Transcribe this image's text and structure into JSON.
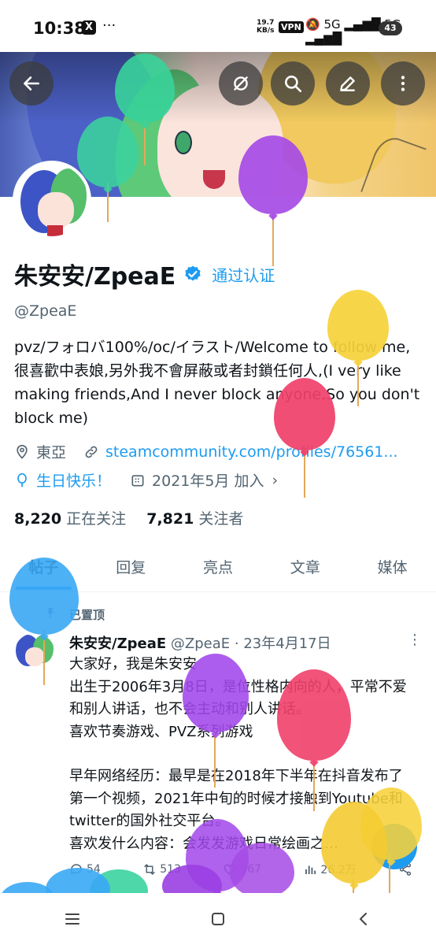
{
  "status_bar": {
    "time": "10:38",
    "x_glyph": "X",
    "more": "···",
    "net_speed_value": "19.7",
    "net_speed_unit": "KB/s",
    "vpn": "VPN",
    "signal_icons": "🔕 5G ▂▄▆█ 5G ▂▄▆█",
    "battery": "43"
  },
  "header": {
    "icons": [
      "back-arrow-icon",
      "refresh-slash-icon",
      "search-icon",
      "edit-pencil-icon",
      "more-vertical-icon"
    ]
  },
  "profile": {
    "name": "朱安安/ZpeaE",
    "verify_label": "通过认证",
    "handle": "@ZpeaE",
    "bio": "pvz/フォロバ100%/oc/イラスト/Welcome to follow me,很喜歡中表娘,另外我不會屏蔽或者封鎖任何人,(I very like making friends,And I never block anyone,So you don't block me)",
    "location": "東亞",
    "link": "steamcommunity.com/profiles/76561...",
    "birthday": "生日快乐！",
    "joined": "2021年5月 加入",
    "following_count": "8,220",
    "following_label": "正在关注",
    "followers_count": "7,821",
    "followers_label": "关注者"
  },
  "tabs": [
    {
      "label": "帖子",
      "active": true
    },
    {
      "label": "回复",
      "active": false
    },
    {
      "label": "亮点",
      "active": false
    },
    {
      "label": "文章",
      "active": false
    },
    {
      "label": "媒体",
      "active": false
    }
  ],
  "post": {
    "pinned_label": "已置顶",
    "author_name": "朱安安/ZpeaE",
    "author_handle": "@ZpeaE",
    "separator": "·",
    "date": "23年4月17日",
    "more": "⋮",
    "lines": [
      "大家好，我是朱安安",
      "出生于2006年3月8日，是位性格内向的人，平常不爱和别人讲话，也不会主动和别人讲话。",
      "喜欢节奏游戏、PVZ系列游戏",
      "",
      "早年网络经历：最早是在2018年下半年在抖音发布了第一个视频，2021年中旬的时候才接触到Youtube和twitter的国外社交平台。",
      "喜欢发什么内容：会发发游戏日常绘画之…"
    ],
    "reply_count": "54",
    "repost_count": "513",
    "like_count": "967",
    "view_count": "26.2万"
  },
  "colors": {
    "accent": "#1d9bf0",
    "text_primary": "#0f1419",
    "text_secondary": "#536471"
  }
}
